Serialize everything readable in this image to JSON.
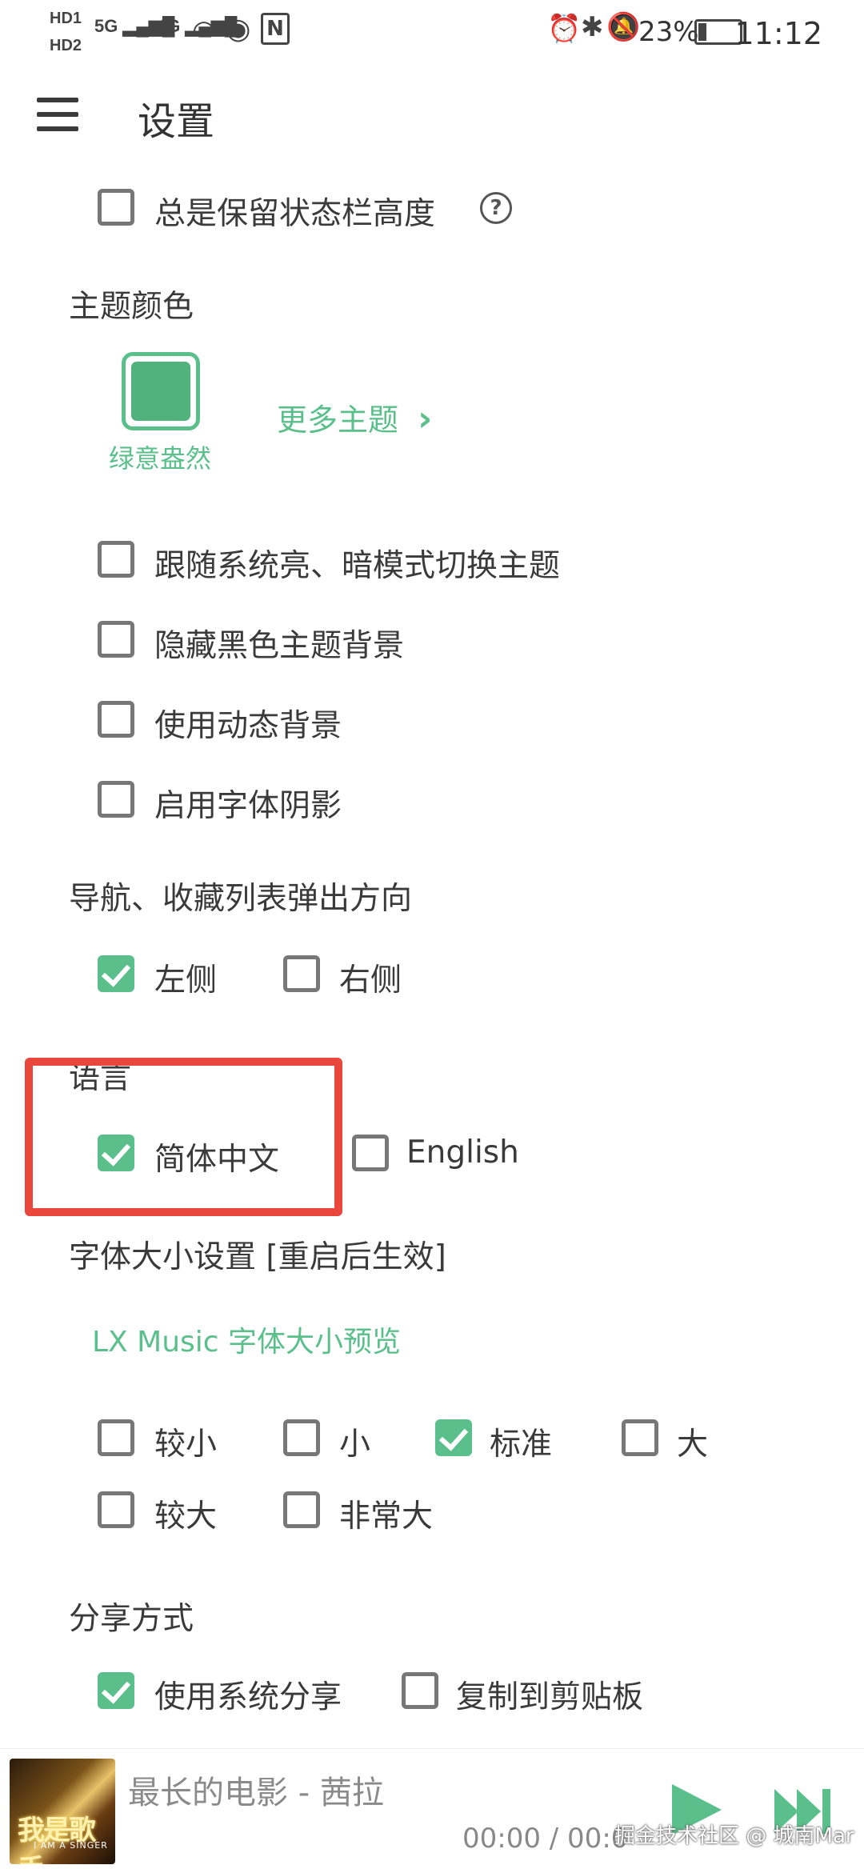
{
  "status_bar": {
    "left_indicators": [
      "HD1",
      "HD2",
      "5G",
      "4G"
    ],
    "battery": "23%",
    "time": "11:12"
  },
  "header": {
    "title": "设置"
  },
  "options": {
    "keep_statusbar": "总是保留状态栏高度",
    "help_glyph": "?"
  },
  "theme": {
    "section_title": "主题颜色",
    "current_name": "绿意盎然",
    "more_label": "更多主题",
    "more_chevron": "›",
    "follow_system": "跟随系统亮、暗模式切换主题",
    "hide_black_bg": "隐藏黑色主题背景",
    "dynamic_bg": "使用动态背景",
    "font_shadow": "启用字体阴影",
    "accent_color": "#5bbf8b"
  },
  "nav_direction": {
    "section_title": "导航、收藏列表弹出方向",
    "left": "左侧",
    "right": "右侧"
  },
  "language": {
    "section_title": "语言",
    "zh": "简体中文",
    "en": "English"
  },
  "font_size": {
    "section_title": "字体大小设置 [重启后生效]",
    "preview": "LX Music 字体大小预览",
    "smaller": "较小",
    "small": "小",
    "standard": "标准",
    "large": "大",
    "larger": "较大",
    "huge": "非常大"
  },
  "share": {
    "section_title": "分享方式",
    "system": "使用系统分享",
    "clipboard": "复制到剪贴板"
  },
  "player": {
    "album_text": "我是歌手",
    "album_sub": "I AM A SINGER",
    "song": "最长的电影 - 茜拉",
    "progress": "00:00 / 00:0",
    "watermark": "掘金技术社区 @ 城南Mar"
  }
}
